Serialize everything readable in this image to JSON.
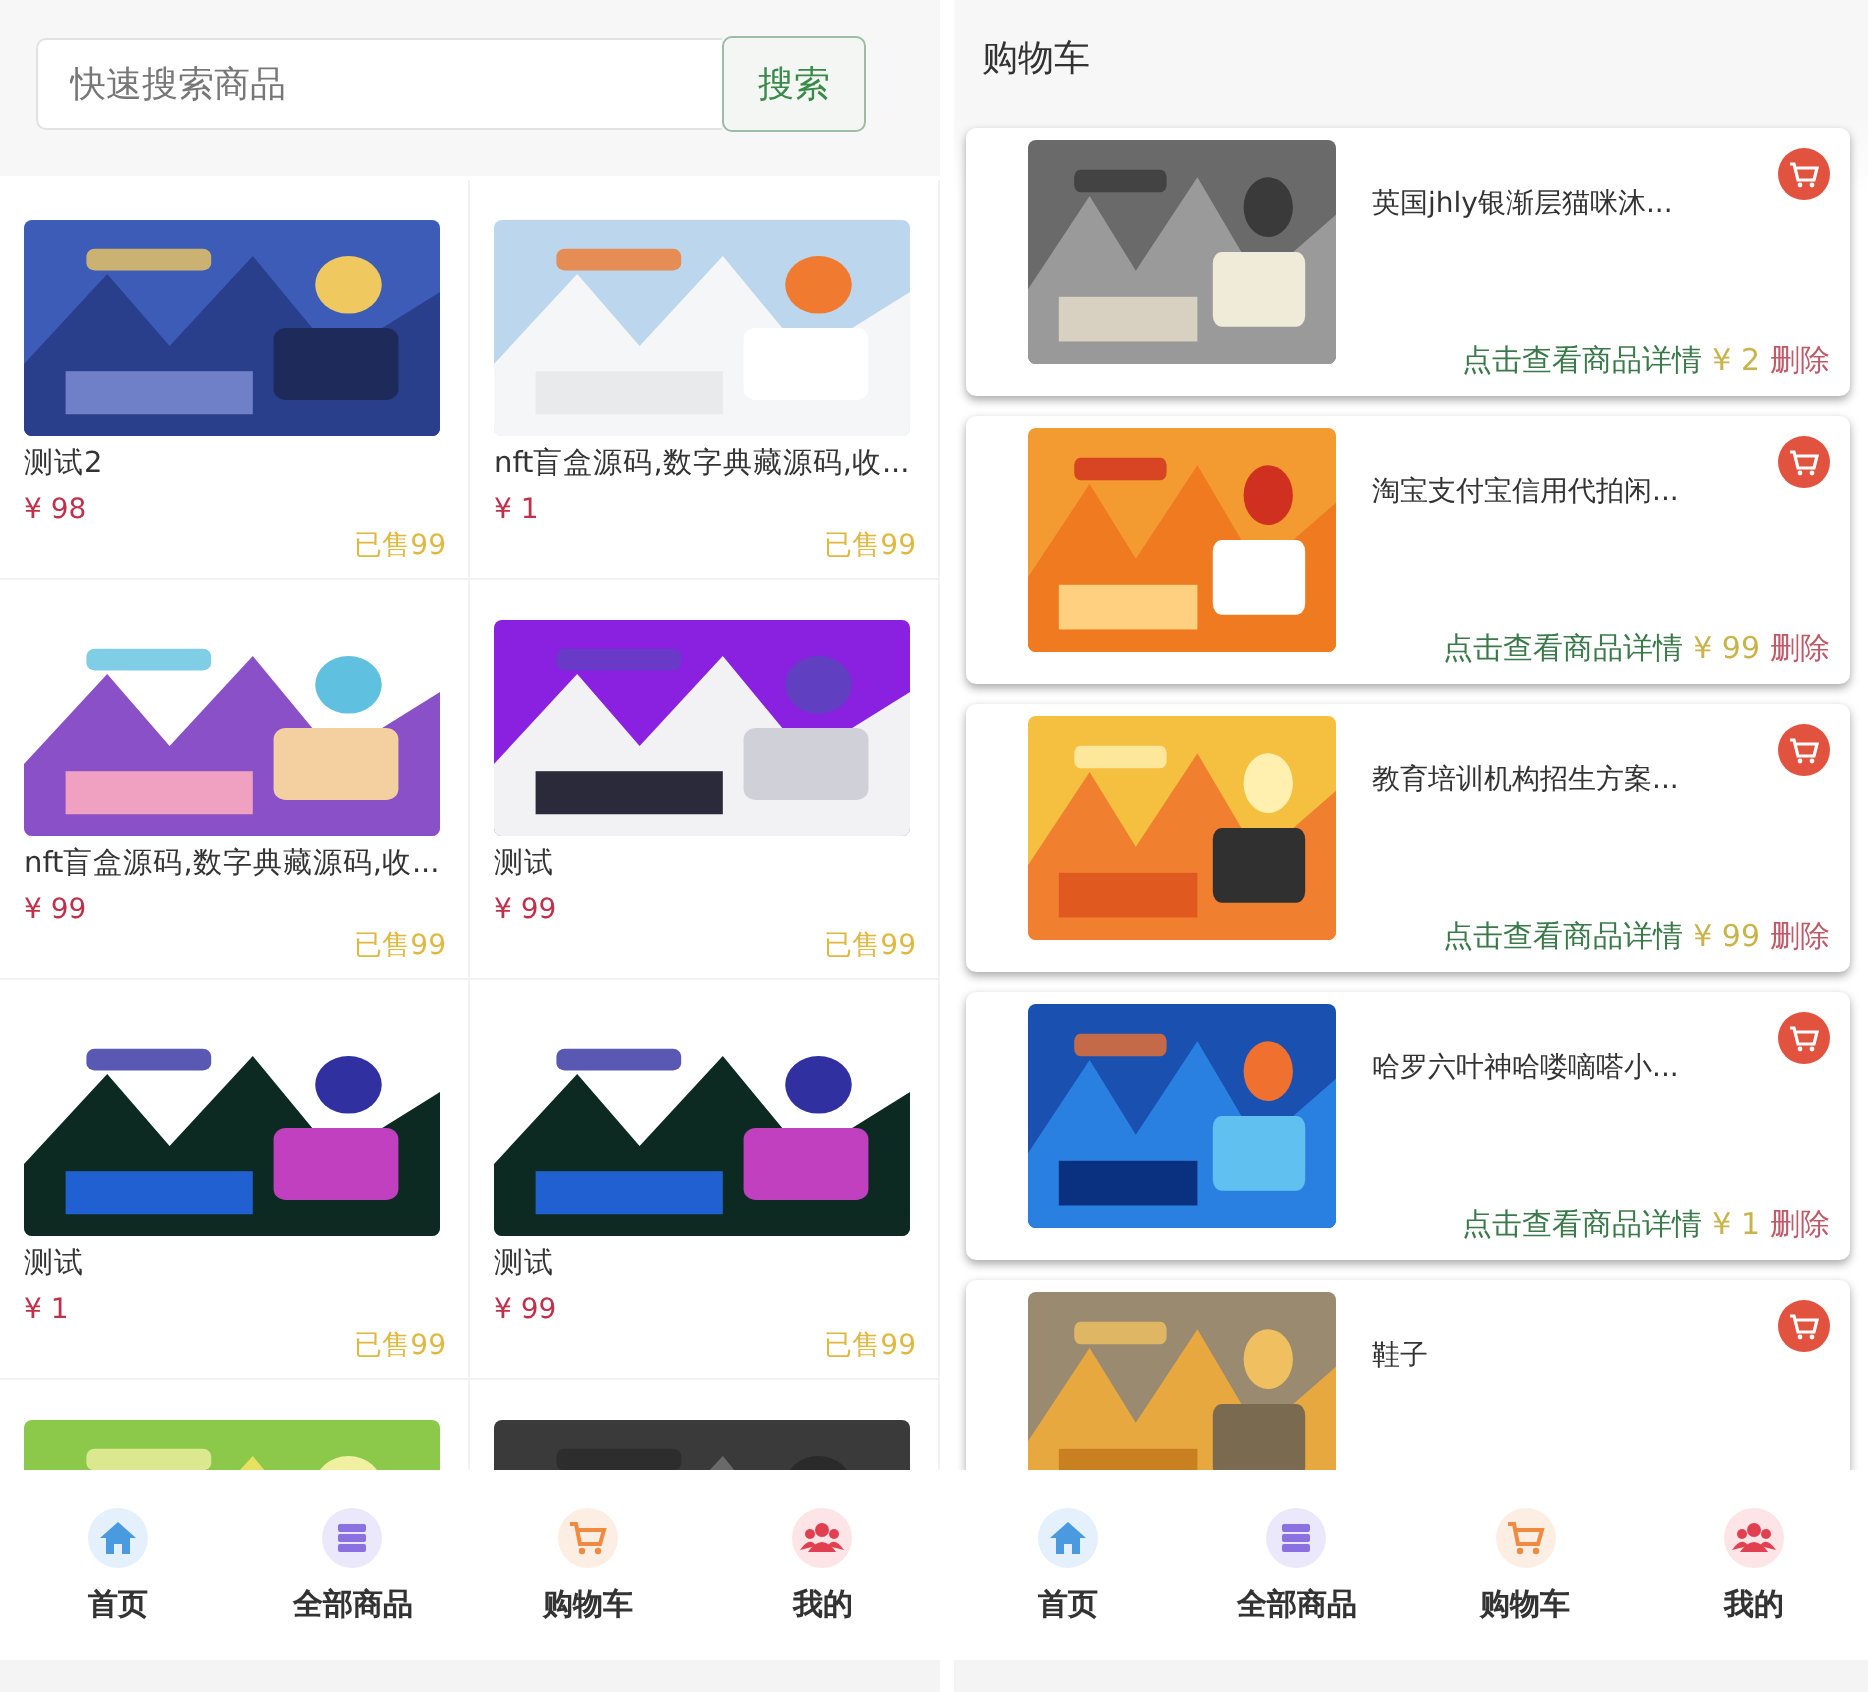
{
  "home": {
    "search": {
      "placeholder": "快速搜索商品",
      "button": "搜索"
    },
    "products": [
      {
        "image": {
          "kind": "picture"
        },
        "title": "测试2",
        "price": "¥ 98",
        "sold": "已售99"
      },
      {
        "image": {
          "kind": "picture"
        },
        "title": "nft盲盒源码,数字典藏源码,收...",
        "price": "¥ 1",
        "sold": "已售99"
      },
      {
        "image": {
          "kind": "picture"
        },
        "title": "nft盲盒源码,数字典藏源码,收...",
        "price": "¥ 99",
        "sold": "已售99"
      },
      {
        "image": {
          "kind": "picture"
        },
        "title": "测试",
        "price": "¥ 99",
        "sold": "已售99"
      },
      {
        "image": {
          "kind": "picture"
        },
        "title": "测试",
        "price": "¥ 1",
        "sold": "已售99"
      },
      {
        "image": {
          "kind": "picture"
        },
        "title": "测试",
        "price": "¥ 99",
        "sold": "已售99"
      },
      {
        "image": {
          "kind": "picture"
        }
      },
      {
        "image": {
          "kind": "picture"
        }
      }
    ],
    "nav": [
      {
        "kind": "home",
        "label": "首页"
      },
      {
        "kind": "store",
        "label": "全部商品"
      },
      {
        "kind": "cart",
        "label": "购物车"
      },
      {
        "kind": "user",
        "label": "我的"
      }
    ]
  },
  "cart": {
    "title": "购物车",
    "items": [
      {
        "image": {
          "kind": "picture"
        },
        "title": "英国jhly银渐层猫咪沐...",
        "detail": "点击查看商品详情",
        "price": "¥ 2",
        "delete": "删除"
      },
      {
        "image": {
          "kind": "picture"
        },
        "title": "淘宝支付宝信用代拍闲...",
        "detail": "点击查看商品详情",
        "price": "¥ 99",
        "delete": "删除"
      },
      {
        "image": {
          "kind": "picture"
        },
        "title": "教育培训机构招生方案...",
        "detail": "点击查看商品详情",
        "price": "¥ 99",
        "delete": "删除"
      },
      {
        "image": {
          "kind": "picture"
        },
        "title": "哈罗六叶神哈喽嘀嗒小...",
        "detail": "点击查看商品详情",
        "price": "¥ 1",
        "delete": "删除"
      },
      {
        "image": {
          "kind": "picture"
        },
        "title": "鞋子"
      }
    ],
    "nav": [
      {
        "kind": "home",
        "label": "首页"
      },
      {
        "kind": "store",
        "label": "全部商品"
      },
      {
        "kind": "cart",
        "label": "购物车"
      },
      {
        "kind": "user",
        "label": "我的"
      }
    ]
  }
}
